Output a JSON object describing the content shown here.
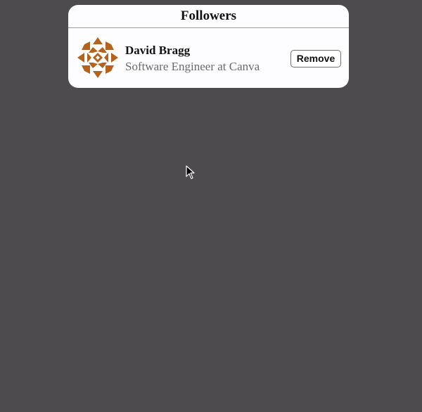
{
  "panel": {
    "title": "Followers"
  },
  "followers": [
    {
      "name": "David Bragg",
      "subtitle": "Software Engineer at Canva",
      "avatar_icon": "identicon-avatar",
      "avatar_color": "#b3631b",
      "remove_label": "Remove"
    }
  ],
  "cursor": {
    "icon": "arrow-pointer-icon"
  }
}
